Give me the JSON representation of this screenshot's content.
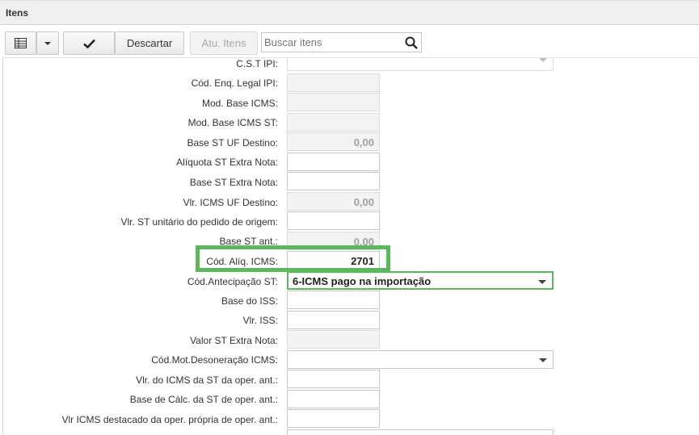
{
  "panel": {
    "title": "Itens"
  },
  "toolbar": {
    "descartar_label": "Descartar",
    "atu_itens_label": "Atu. Itens",
    "search_placeholder": "Buscar itens"
  },
  "form": {
    "rows": [
      {
        "label": "C.S.T IPI:",
        "value": ""
      },
      {
        "label": "Cód. Enq. Legal IPI:",
        "value": ""
      },
      {
        "label": "Mod. Base ICMS:",
        "value": ""
      },
      {
        "label": "Mod. Base ICMS ST:",
        "value": ""
      },
      {
        "label": "Base ST UF Destino:",
        "value": "0,00"
      },
      {
        "label": "Alíquota ST Extra Nota:",
        "value": ""
      },
      {
        "label": "Base ST Extra Nota:",
        "value": ""
      },
      {
        "label": "Vlr. ICMS UF Destino:",
        "value": "0,00"
      },
      {
        "label": "Vlr. ST unitário do pedido de origem:",
        "value": ""
      },
      {
        "label": "Base ST ant.:",
        "value": "0,00"
      },
      {
        "label": "Cód. Alíq. ICMS:",
        "value": "2701"
      },
      {
        "label": "Cód.Antecipação ST:",
        "value": "6-ICMS pago na importação"
      },
      {
        "label": "Base do ISS:",
        "value": ""
      },
      {
        "label": "Vlr. ISS:",
        "value": ""
      },
      {
        "label": "Valor ST Extra Nota:",
        "value": ""
      },
      {
        "label": "Cód.Mot.Desoneração ICMS:",
        "value": ""
      },
      {
        "label": "Vlr. do ICMS da ST da oper. ant.:",
        "value": ""
      },
      {
        "label": "Base de Cálc. da ST de oper. ant.:",
        "value": ""
      },
      {
        "label": "Vlr ICMS destacado da oper. própria de oper. ant.:",
        "value": ""
      }
    ]
  }
}
